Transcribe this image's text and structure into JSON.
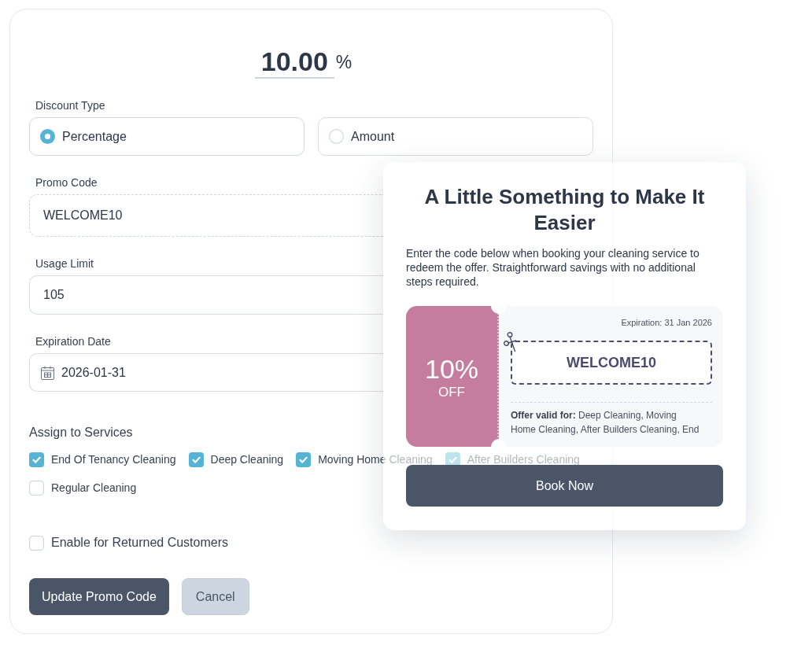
{
  "discount": {
    "value": "10.00",
    "unit": "%"
  },
  "discount_type": {
    "label": "Discount Type",
    "options": [
      {
        "label": "Percentage",
        "selected": true
      },
      {
        "label": "Amount",
        "selected": false
      }
    ]
  },
  "promo_code": {
    "label": "Promo Code",
    "value": "WELCOME10"
  },
  "usage_limit": {
    "label": "Usage Limit",
    "value": "105"
  },
  "expiration_date": {
    "label": "Expiration Date",
    "value": "2026-01-31"
  },
  "services": {
    "label": "Assign to Services",
    "items": [
      {
        "label": "End Of Tenancy Cleaning",
        "checked": true
      },
      {
        "label": "Deep Cleaning",
        "checked": true
      },
      {
        "label": "Moving Home Cleaning",
        "checked": true
      },
      {
        "label": "After Builders Cleaning",
        "checked": true
      },
      {
        "label": "Regular Cleaning",
        "checked": false
      }
    ]
  },
  "returned_customers": {
    "label": "Enable for Returned Customers",
    "checked": false
  },
  "buttons": [
    {
      "label": "Update Promo Code",
      "kind": "primary"
    },
    {
      "label": "Cancel",
      "kind": "secondary"
    }
  ],
  "popup": {
    "title": "A Little Something to Make It Easier",
    "description": "Enter the code below when booking your cleaning service to redeem the offer. Straightforward savings with no additional steps required.",
    "coupon": {
      "discount": "10%",
      "off": "OFF",
      "expiration": "Expiration: 31 Jan 2026",
      "code": "WELCOME10",
      "offer": "**Offer valid for:** Deep Cleaning, Moving Home Cleaning, After Builders Cleaning, End"
    },
    "button": "Book Now"
  }
}
